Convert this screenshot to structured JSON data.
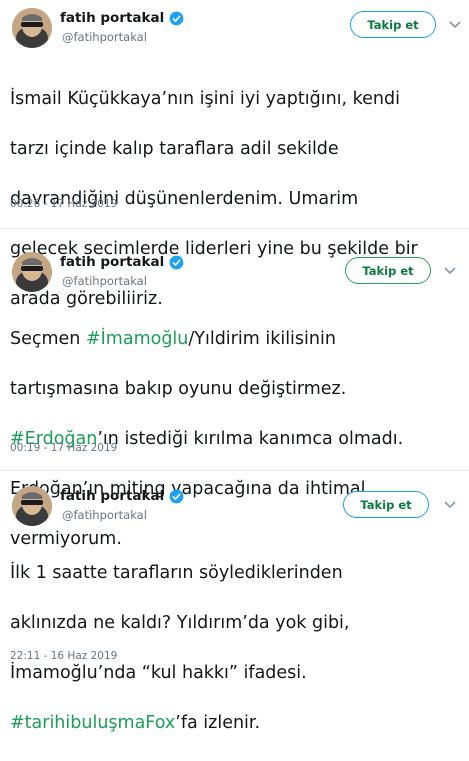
{
  "tweets": [
    {
      "name": "fatih portakal",
      "handle": "@fatihportakal",
      "follow_label": "Takip et",
      "lines": [
        "İsmail Küçükkaya’nın işini iyi yaptığını, kendi",
        "tarzı içinde kalıp taraflara adil sekilde",
        "davrandiğini düşünenlerdenim. Umarim",
        "gelecek secimlerde liderleri yine bu şekilde bir",
        "arada görebiliiriz."
      ],
      "timestamp": "00:26 - 17 Haz 2019"
    },
    {
      "name": "fatih portakal",
      "handle": "@fatihportakal",
      "follow_label": "Takip et",
      "line1_pre": "Seçmen ",
      "line1_tag": "#İmamoğlu",
      "line1_post": "/Yıldirim ikilisinin",
      "line2": "tartışmasına bakıp oyunu değiştirmez.",
      "line3_tag": "#Erdoğan",
      "line3_post": "’ın istediği kırılma kanımca olmadı.",
      "line4": "Erdoğan’ın miting yapacağına da ihtimal",
      "line5": "vermiyorum.",
      "timestamp": "00:19 - 17 Haz 2019"
    },
    {
      "name": "fatih portakal",
      "handle": "@fatihportakal",
      "follow_label": "Takip et",
      "line1": "İlk 1 saatte tarafların söylediklerinden",
      "line2": "aklınızda ne kaldı? Yıldırım’da yok gibi,",
      "line3": "İmamoğlu’nda “kul hakkı” ifadesi.",
      "line4_tag": "#tarihibuluşmaFox",
      "line4_post": "’fa izlenir.",
      "timestamp": "22:11 - 16 Haz 2019"
    }
  ],
  "colors": {
    "hashtag": "#1a9e58",
    "verified": "#1da1f2",
    "follow_text": "#0c7a3f",
    "muted": "#657786"
  },
  "icons": [
    "verified-badge-icon",
    "chevron-down-icon",
    "avatar"
  ]
}
